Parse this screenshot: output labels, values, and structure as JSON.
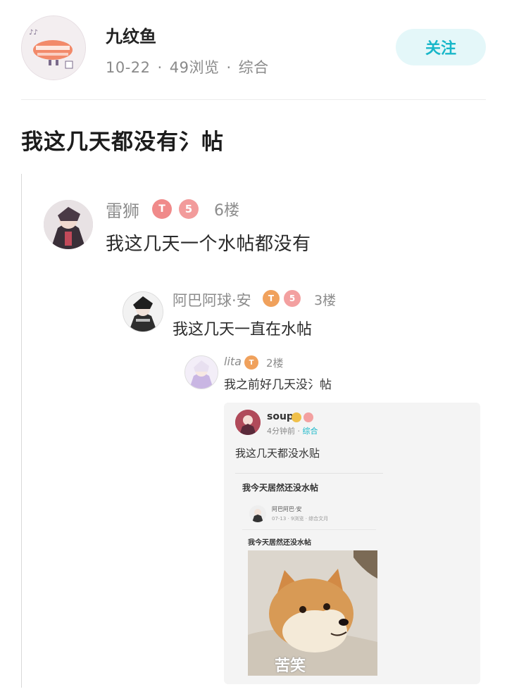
{
  "header": {
    "author_name": "九纹鱼",
    "date": "10-22",
    "views": "49浏览",
    "category": "综合",
    "meta_separator": "·",
    "follow_label": "关注"
  },
  "post": {
    "title": "我这几天都没有氵帖"
  },
  "quotes": [
    {
      "user": "雷狮",
      "floor": "6楼",
      "text": "我这几天一个水帖都没有",
      "badges": [
        "T",
        "5"
      ]
    },
    {
      "user": "阿巴阿球·安",
      "floor": "3楼",
      "text": "我这几天一直在水帖",
      "badges": [
        "T",
        "5"
      ]
    },
    {
      "user": "lita",
      "floor": "2楼",
      "text": "我之前好几天没氵帖",
      "badges": [
        "T"
      ]
    }
  ],
  "embedded": {
    "user": "soup",
    "time": "4分钟前",
    "category": "综合",
    "text1": "我这几天都没水贴",
    "text2": "我今天居然还没水帖",
    "nested_user": "阿巴阿巴·安",
    "nested_meta": "07-13 · 9浏览 · 综合文月",
    "text3": "我今天居然还没水帖",
    "meme_caption": "苦笑"
  },
  "colors": {
    "accent": "#18b7c9",
    "follow_bg": "#e4f7f9",
    "muted_text": "#8c8c8c"
  }
}
